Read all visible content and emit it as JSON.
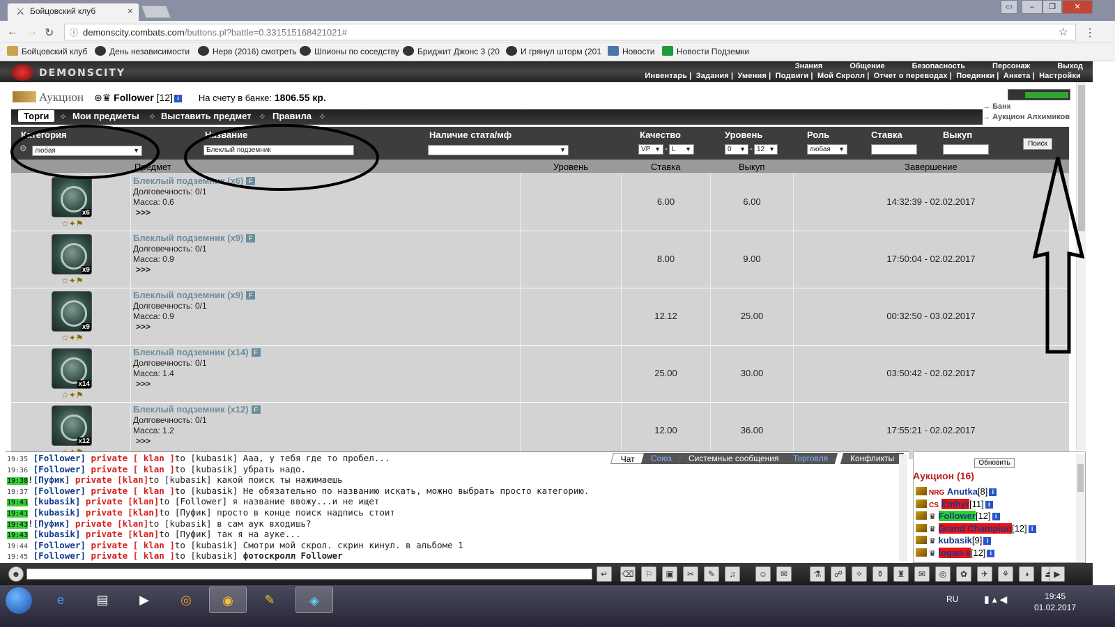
{
  "browser": {
    "tab_title": "Бойцовский клуб",
    "tab_close": "×",
    "url_host": "demonscity.combats.com",
    "url_path": "/buttons.pl?battle=0.331515168421021#",
    "bookmarks": [
      "Бойцовский клуб",
      "День независимости",
      "Нерв (2016) смотреть",
      "Шпионы по соседству",
      "Бриджит Джонс 3 (20",
      "И грянул шторм (201",
      "Новости",
      "Новости Подземки"
    ]
  },
  "game": {
    "logo": "DEMONSCITY",
    "top_menu": [
      "Знания",
      "Общение",
      "Безопасность",
      "Персонаж",
      "Выход"
    ],
    "sub_menu": [
      "Инвентарь",
      "Задания",
      "Умения",
      "Подвиги",
      "Мой Скролл",
      "Отчет о переводах",
      "Поединки",
      "Анкета",
      "Настройки"
    ],
    "auction_title": "Аукцион",
    "user_name": "Follower",
    "user_level": "[12]",
    "bank_label": "На счету в банке:",
    "bank_value": "1806.55 кр.",
    "side_links": [
      "Банк",
      "Аукцион Алхимиков"
    ],
    "tabs": [
      "Торги",
      "Мои предметы",
      "Выставить предмет",
      "Правила"
    ],
    "filters": {
      "category_label": "Категория",
      "category_value": "любая",
      "name_label": "Название",
      "name_value": "Блеклый подземник",
      "stat_label": "Наличие стата/мф",
      "quality_label": "Качество",
      "quality_from": "VP",
      "quality_to": "L",
      "level_label": "Уровень",
      "level_from": "0",
      "level_to": "12",
      "role_label": "Роль",
      "role_value": "любая",
      "bid_label": "Ставка",
      "buyout_label": "Выкуп",
      "search_button": "Поиск"
    },
    "table_headers": [
      "Предмет",
      "Уровень",
      "Ставка",
      "Выкуп",
      "Завершение"
    ],
    "rows": [
      {
        "name": "Блеклый подземник (x6)",
        "count": "x6",
        "durability": "Долговечность: 0/1",
        "mass": "Масса: 0.6",
        "more": ">>>",
        "bid": "6.00",
        "buyout": "6.00",
        "end": "14:32:39 - 02.02.2017"
      },
      {
        "name": "Блеклый подземник (x9)",
        "count": "x9",
        "durability": "Долговечность: 0/1",
        "mass": "Масса: 0.9",
        "more": ">>>",
        "bid": "8.00",
        "buyout": "9.00",
        "end": "17:50:04 - 02.02.2017"
      },
      {
        "name": "Блеклый подземник (x9)",
        "count": "x9",
        "durability": "Долговечность: 0/1",
        "mass": "Масса: 0.9",
        "more": ">>>",
        "bid": "12.12",
        "buyout": "25.00",
        "end": "00:32:50 - 03.02.2017"
      },
      {
        "name": "Блеклый подземник (x14)",
        "count": "x14",
        "durability": "Долговечность: 0/1",
        "mass": "Масса: 1.4",
        "more": ">>>",
        "bid": "25.00",
        "buyout": "30.00",
        "end": "03:50:42 - 02.02.2017"
      },
      {
        "name": "Блеклый подземник (x12)",
        "count": "x12",
        "durability": "Долговечность: 0/1",
        "mass": "Масса: 1.2",
        "more": ">>>",
        "bid": "12.00",
        "buyout": "36.00",
        "end": "17:55:21 - 02.02.2017"
      }
    ],
    "fbadge": "F"
  },
  "chat": {
    "tabs": [
      "Чат",
      "Союз",
      "Системные сообщения",
      "Торговля",
      "Конфликты"
    ],
    "lines": [
      {
        "time": "19:35",
        "from": "Follower",
        "priv": "private [ klan ]",
        "to": "to [kubasik]",
        "msg": "Ааа, у тебя где то пробел...",
        "hl": false,
        "bang": false
      },
      {
        "time": "19:36",
        "from": "Follower",
        "priv": "private [ klan ]",
        "to": "to [kubasik]",
        "msg": "убрать надо.",
        "hl": false,
        "bang": false
      },
      {
        "time": "19:38",
        "from": "Пуфик",
        "priv": "private [klan]",
        "to": "to [kubasik]",
        "msg": "какой поиск ты нажимаешь",
        "hl": true,
        "bang": true
      },
      {
        "time": "19:37",
        "from": "Follower",
        "priv": "private [ klan ]",
        "to": "to [kubasik]",
        "msg": "Не обязательно по названию искать, можно выбрать просто категорию.",
        "hl": false,
        "bang": false
      },
      {
        "time": "19:41",
        "from": "kubasik",
        "priv": "private [klan]",
        "to": "to [Follower]",
        "msg": "я название ввожу...и не ищет",
        "hl": true,
        "bang": false
      },
      {
        "time": "19:41",
        "from": "kubasik",
        "priv": "private [klan]",
        "to": "to [Пуфик]",
        "msg": "просто в конце поиск надпись стоит",
        "hl": true,
        "bang": false
      },
      {
        "time": "19:43",
        "from": "Пуфик",
        "priv": "private [klan]",
        "to": "to [kubasik]",
        "msg": "в сам аук входишь?",
        "hl": true,
        "bang": true
      },
      {
        "time": "19:43",
        "from": "kubasik",
        "priv": "private [klan]",
        "to": "to [Пуфик]",
        "msg": "так я на ауке...",
        "hl": true,
        "bang": false
      },
      {
        "time": "19:44",
        "from": "Follower",
        "priv": "private [ klan ]",
        "to": "to [kubasik]",
        "msg": "Смотри мой скрол. скрин кинул. в альбоме 1",
        "hl": false,
        "bang": false
      },
      {
        "time": "19:45",
        "from": "Follower",
        "priv": "private [ klan ]",
        "to": "to [kubasik]",
        "msg": "фотоскролл Follower",
        "hl": false,
        "bang": false
      }
    ]
  },
  "who": {
    "refresh": "Обновить",
    "title": "Аукцион (16)",
    "users": [
      {
        "prefix": "NRG",
        "nick": "Anutka",
        "level": "[8]",
        "bg": "",
        "color": "#123a8c"
      },
      {
        "prefix": "CS",
        "nick": "Emhyr",
        "level": "[11]",
        "bg": "#e11",
        "color": "#123a8c"
      },
      {
        "prefix": "",
        "nick": "Follower",
        "level": "[12]",
        "bg": "#2fcf2f",
        "color": "#123a8c"
      },
      {
        "prefix": "",
        "nick": "Grand Champion",
        "level": "[12]",
        "bg": "#e11",
        "color": "#123a8c"
      },
      {
        "prefix": "",
        "nick": "kubasik",
        "level": "[9]",
        "bg": "",
        "color": "#123a8c"
      },
      {
        "prefix": "",
        "nick": "logan-x",
        "level": "[12]",
        "bg": "#e11",
        "color": "#123a8c"
      }
    ]
  },
  "taskbar": {
    "lang": "RU",
    "time": "19:45",
    "date": "01.02.2017"
  }
}
